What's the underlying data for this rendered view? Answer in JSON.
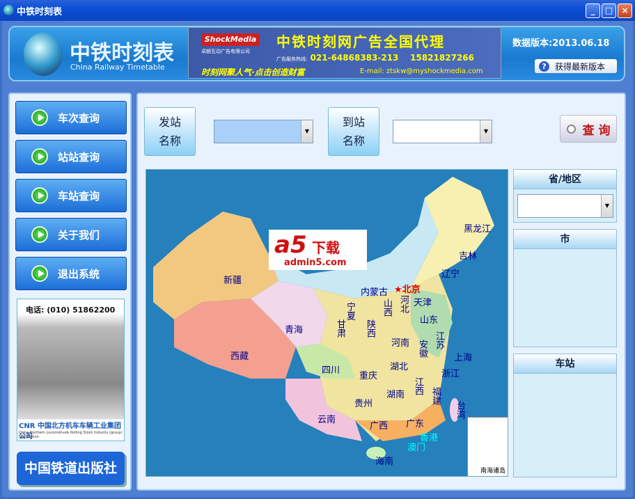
{
  "window": {
    "title": "中铁时刻表",
    "min": "_",
    "max": "□",
    "close": "×"
  },
  "header": {
    "title": "中铁时刻表",
    "subtitle": "China Railway Timetable",
    "ad": {
      "brand": "ShockMedia",
      "company": "卓朗互动广告有限公司",
      "headline": "中铁时刻网广告全国代理",
      "hotline_label": "广告服务热线:",
      "phone1": "021-64868383-213",
      "phone2": "15821827266",
      "slogan": "时刻网聚人气·点击创造财富",
      "email": "E-mail: ztskw@myshockmedia.com"
    },
    "version": "数据版本:2013.06.18",
    "update_button": "获得最新版本"
  },
  "sidebar": {
    "items": [
      {
        "label": "车次查询"
      },
      {
        "label": "站站查询"
      },
      {
        "label": "车站查询"
      },
      {
        "label": "关于我们"
      },
      {
        "label": "退出系统"
      }
    ],
    "promo": {
      "phone": "电话: (010) 51862200",
      "company": "CNR 中国北方机车车辆工业集团公司",
      "company_en": "China Northern Locomotive& Rolling Stock Industry (group) corporation"
    },
    "publisher": "中国铁道出版社"
  },
  "search": {
    "from_label": "发站\n名称",
    "from_value": "",
    "to_label": "到站\n名称",
    "to_value": "",
    "query_button": "查 询"
  },
  "map": {
    "watermark_logo": "a5下载",
    "watermark_url": "admin5.com",
    "inset": "南海诸岛",
    "provinces": [
      "新疆",
      "西藏",
      "青海",
      "内蒙古",
      "黑龙江",
      "吉林",
      "辽宁",
      "★北京",
      "天津",
      "河北",
      "山西",
      "宁夏",
      "山东",
      "甘肃",
      "陕西",
      "河南",
      "江苏",
      "安徽",
      "上海",
      "四川",
      "重庆",
      "湖北",
      "浙江",
      "湖南",
      "江西",
      "福建",
      "贵州",
      "云南",
      "广西",
      "广东",
      "台湾",
      "香港",
      "澳门",
      "海南"
    ]
  },
  "panels": {
    "province": "省/地区",
    "city": "市",
    "station": "车站"
  }
}
